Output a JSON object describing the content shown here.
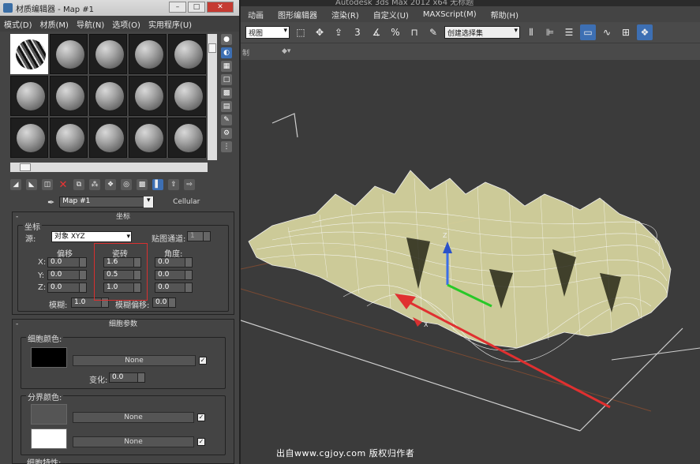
{
  "app": {
    "title": "Autodesk 3ds Max  2012 x64    无标题",
    "menu": [
      "动画",
      "图形编辑器",
      "渲染(R)",
      "自定义(U)",
      "MAXScript(M)",
      "帮助(H)"
    ],
    "toolbar": {
      "view_dropdown": "视图",
      "snap_label": "3",
      "selection_set": "创建选择集"
    },
    "ribbon_left": "制",
    "viewport": {
      "axis_x": "X",
      "axis_z": "Z"
    }
  },
  "editor": {
    "title": "材质编辑器 - Map #1",
    "btn_min": "–",
    "btn_max": "□",
    "btn_close": "✕",
    "menu": [
      "模式(D)",
      "材质(M)",
      "导航(N)",
      "选项(O)",
      "实用程序(U)"
    ],
    "map_name": "Map #1",
    "map_type": "Cellular"
  },
  "coords": {
    "header": "坐标",
    "group_label": "坐标",
    "source_label": "源:",
    "source_value": "对象 XYZ",
    "channel_label": "贴图通道:",
    "channel_value": "1",
    "offset_label": "偏移",
    "tiling_label": "瓷砖",
    "angle_label": "角度:",
    "rows": [
      {
        "axis": "X:",
        "offset": "0.0",
        "tiling": "1.6",
        "angle": "0.0"
      },
      {
        "axis": "Y:",
        "offset": "0.0",
        "tiling": "0.5",
        "angle": "0.0"
      },
      {
        "axis": "Z:",
        "offset": "0.0",
        "tiling": "1.0",
        "angle": "0.0"
      }
    ],
    "blur_label": "模糊:",
    "blur_value": "1.0",
    "blur_offset_label": "模糊偏移:",
    "blur_offset_value": "0.0"
  },
  "cell": {
    "header": "细胞参数",
    "cell_color_label": "细胞颜色:",
    "none": "None",
    "check_mark": "✓",
    "variation_label": "变化:",
    "variation_value": "0.0",
    "division_label": "分界颜色:",
    "characteristics_label": "细胞特性:"
  },
  "watermark": "出自www.cgjoy.com 版权归作者"
}
